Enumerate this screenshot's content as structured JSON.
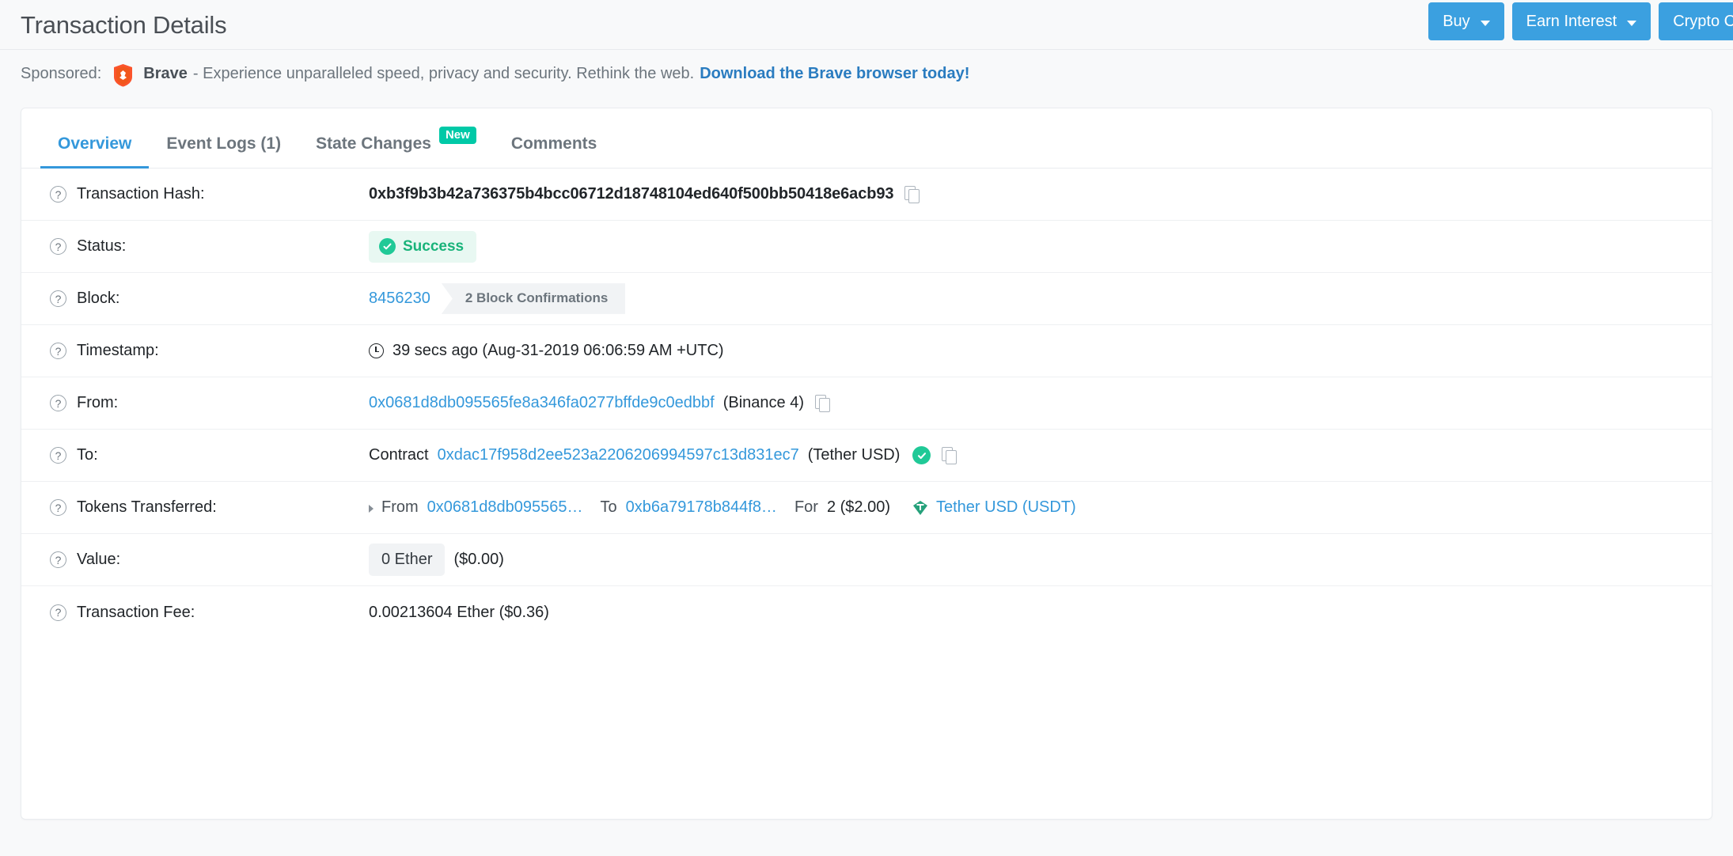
{
  "header": {
    "title": "Transaction Details",
    "buttons": [
      {
        "label": "Buy",
        "has_caret": true
      },
      {
        "label": "Earn Interest",
        "has_caret": true
      },
      {
        "label": "Crypto Credit",
        "has_caret": false
      }
    ]
  },
  "sponsored": {
    "label": "Sponsored:",
    "brand": "Brave",
    "text": "- Experience unparalleled speed, privacy and security. Rethink the web.",
    "link": "Download the Brave browser today!",
    "icon": "brave-lion-icon"
  },
  "tabs": [
    {
      "label": "Overview",
      "active": true,
      "badge": ""
    },
    {
      "label": "Event Logs (1)",
      "active": false,
      "badge": ""
    },
    {
      "label": "State Changes",
      "active": false,
      "badge": "New"
    },
    {
      "label": "Comments",
      "active": false,
      "badge": ""
    }
  ],
  "rows": {
    "transaction_hash": {
      "label": "Transaction Hash:",
      "value": "0xb3f9b3b42a736375b4bcc06712d18748104ed640f500bb50418e6acb93"
    },
    "status": {
      "label": "Status:",
      "value": "Success"
    },
    "block": {
      "label": "Block:",
      "number": "8456230",
      "confirmations": "2 Block Confirmations"
    },
    "timestamp": {
      "label": "Timestamp:",
      "value": "39 secs ago (Aug-31-2019 06:06:59 AM +UTC)"
    },
    "from": {
      "label": "From:",
      "address": "0x0681d8db095565fe8a346fa0277bffde9c0edbbf",
      "tag": "(Binance 4)"
    },
    "to": {
      "label": "To:",
      "prefix": "Contract",
      "address": "0xdac17f958d2ee523a2206206994597c13d831ec7",
      "tag": "(Tether USD)"
    },
    "tokens_transferred": {
      "label": "Tokens Transferred:",
      "from_label": "From",
      "from_address": "0x0681d8db095565…",
      "to_label": "To",
      "to_address": "0xb6a79178b844f8…",
      "for_label": "For",
      "amount": "2 ($2.00)",
      "token": "Tether USD (USDT)"
    },
    "value": {
      "label": "Value:",
      "amount": "0 Ether",
      "fiat": "($0.00)"
    },
    "transaction_fee": {
      "label": "Transaction Fee:",
      "value": "0.00213604 Ether ($0.36)"
    }
  },
  "colors": {
    "accent": "#3498db",
    "success": "#20c997",
    "badge_new": "#00c9a7",
    "brave": "#fb542b"
  }
}
